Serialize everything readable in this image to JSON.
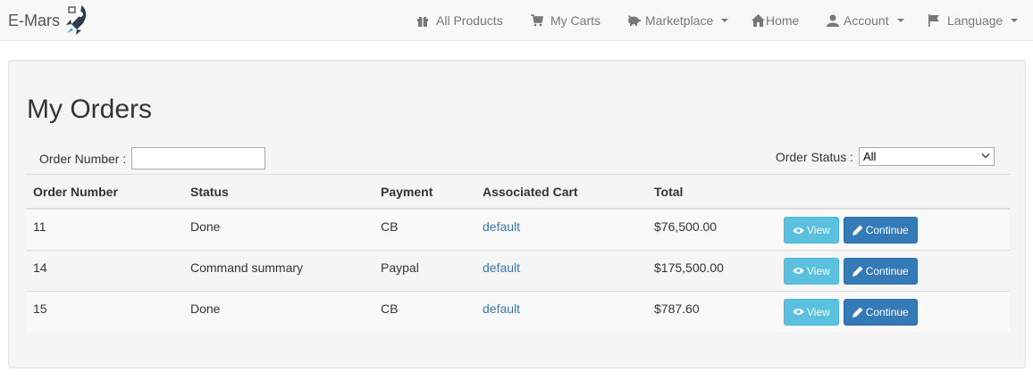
{
  "brand": {
    "name": "E-Mars"
  },
  "nav": {
    "all_products": "All Products",
    "my_carts": "My Carts",
    "marketplace": "Marketplace",
    "home": "Home",
    "account": "Account",
    "language": "Language"
  },
  "page": {
    "title": "My Orders"
  },
  "filters": {
    "order_number_label": "Order Number :",
    "order_number_value": "",
    "order_status_label": "Order Status :",
    "order_status_value": "All"
  },
  "table": {
    "headers": [
      "Order Number",
      "Status",
      "Payment",
      "Associated Cart",
      "Total",
      ""
    ],
    "rows": [
      {
        "order_number": "11",
        "status": "Done",
        "payment": "CB",
        "cart": "default",
        "total": "$76,500.00"
      },
      {
        "order_number": "14",
        "status": "Command summary",
        "payment": "Paypal",
        "cart": "default",
        "total": "$175,500.00"
      },
      {
        "order_number": "15",
        "status": "Done",
        "payment": "CB",
        "cart": "default",
        "total": "$787.60"
      }
    ],
    "view_label": "View",
    "continue_label": "Continue"
  },
  "icons": {
    "brand": "rocket-icon",
    "all_products": "gift-icon",
    "my_carts": "cart-icon",
    "marketplace": "piggy-bank-icon",
    "home": "home-icon",
    "account": "user-icon",
    "language": "flag-icon",
    "view": "eye-icon",
    "continue": "pencil-icon"
  },
  "colors": {
    "view_button": "#5bc0de",
    "continue_button": "#337ab7",
    "link": "#337ab7"
  }
}
